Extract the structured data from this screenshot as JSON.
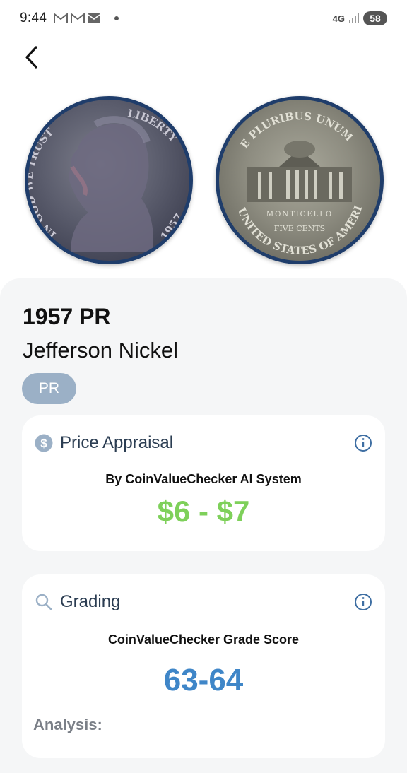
{
  "status_bar": {
    "time": "9:44",
    "notification_icons": [
      "gmail-icon",
      "gmail-icon",
      "mail-icon"
    ],
    "network": "4G",
    "battery": "58"
  },
  "coin": {
    "year_grade": "1957 PR",
    "name": "Jefferson Nickel",
    "tag": "PR",
    "obverse_inscriptions": [
      "IN GOD WE TRUST",
      "LIBERTY",
      "1957"
    ],
    "reverse_inscriptions": [
      "E PLURIBUS UNUM",
      "MONTICELLO",
      "FIVE CENTS",
      "UNITED STATES OF AMERICA"
    ]
  },
  "price_card": {
    "title": "Price Appraisal",
    "subtitle": "By CoinValueChecker AI System",
    "value": "$6 - $7",
    "icon": "dollar-icon"
  },
  "grading_card": {
    "title": "Grading",
    "subtitle": "CoinValueChecker Grade Score",
    "value": "63-64",
    "analysis_label": "Analysis:",
    "icon": "search-icon"
  },
  "colors": {
    "accent_green": "#7ed05a",
    "accent_blue": "#3f86c8",
    "chip": "#9bb0c6",
    "coin_rim": "#1f3d6b"
  }
}
